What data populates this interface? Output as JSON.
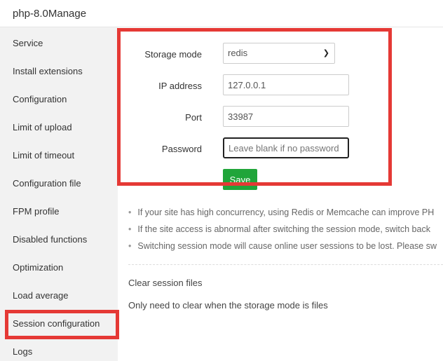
{
  "title": "php-8.0Manage",
  "sidebar": {
    "items": [
      "Service",
      "Install extensions",
      "Configuration",
      "Limit of upload",
      "Limit of timeout",
      "Configuration file",
      "FPM profile",
      "Disabled functions",
      "Optimization",
      "Load average",
      "Session configuration",
      "Logs"
    ],
    "active": "Session configuration"
  },
  "form": {
    "storage_label": "Storage mode",
    "storage_value": "redis",
    "ip_label": "IP address",
    "ip_value": "127.0.0.1",
    "port_label": "Port",
    "port_value": "33987",
    "password_label": "Password",
    "password_placeholder": "Leave blank if no password",
    "save_label": "Save"
  },
  "tips": [
    "If your site has high concurrency, using Redis or Memcache can improve PH",
    "If the site access is abnormal after switching the session mode, switch back",
    "Switching session mode will cause online user sessions to be lost. Please sw"
  ],
  "clear": {
    "title": "Clear session files",
    "note": "Only need to clear when the storage mode is files"
  },
  "colors": {
    "highlight": "#e53935",
    "save": "#20a53a"
  }
}
